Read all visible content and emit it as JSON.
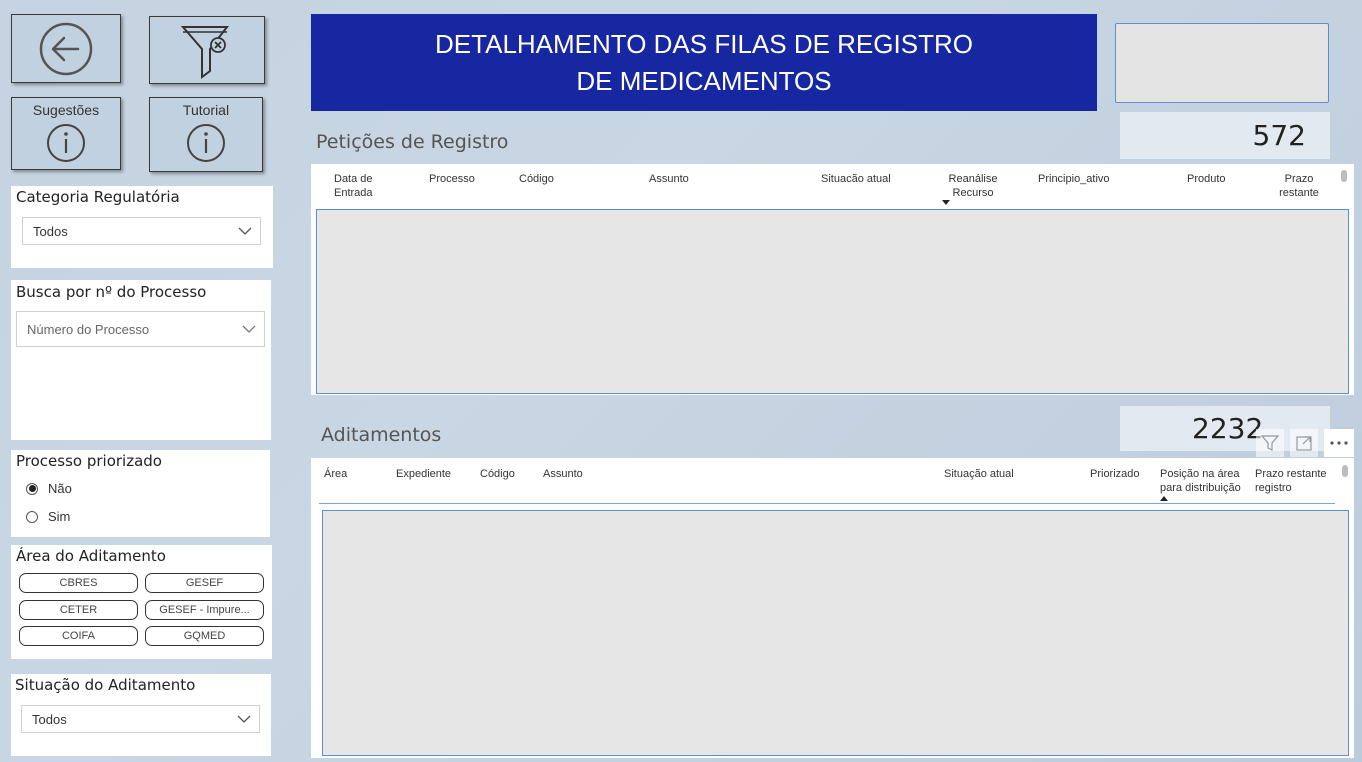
{
  "nav": {
    "back_icon": "arrow-left-circle-icon",
    "filter_icon": "filter-clear-icon",
    "suggestions_label": "Sugestões",
    "tutorial_label": "Tutorial",
    "info_icon": "info-circle-icon"
  },
  "header": {
    "title": "DETALHAMENTO DAS FILAS DE REGISTRO DE MEDICAMENTOS"
  },
  "filters": {
    "categoria": {
      "title": "Categoria Regulatória",
      "value": "Todos"
    },
    "busca": {
      "title": "Busca por nº do Processo",
      "placeholder": "Número do Processo"
    },
    "priorizado": {
      "title": "Processo priorizado",
      "options": [
        "Não",
        "Sim"
      ],
      "selected": "Não"
    },
    "area": {
      "title": "Área do Aditamento",
      "chips": [
        "CBRES",
        "GESEF",
        "CETER",
        "GESEF - Impure...",
        "COIFA",
        "GQMED"
      ]
    },
    "situacao": {
      "title": "Situação do Aditamento",
      "value": "Todos"
    }
  },
  "peticoes": {
    "title": "Petições de Registro",
    "count": "572",
    "columns": [
      "Data de Entrada",
      "Processo",
      "Código",
      "Assunto",
      "Situacão atual",
      "Reanálise Recurso",
      "Principio_ativo",
      "Produto",
      "Prazo restante"
    ]
  },
  "aditamentos": {
    "title": "Aditamentos",
    "count": "2232",
    "columns": [
      "Área",
      "Expediente",
      "Código",
      "Assunto",
      "Situação atual",
      "Priorizado",
      "Posição na área para distribuição",
      "Prazo restante registro"
    ],
    "toolbar_icons": [
      "filter-icon",
      "focus-mode-icon",
      "more-options-icon"
    ]
  },
  "colors": {
    "banner": "#1727a1",
    "accent": "#5b8fd0"
  }
}
